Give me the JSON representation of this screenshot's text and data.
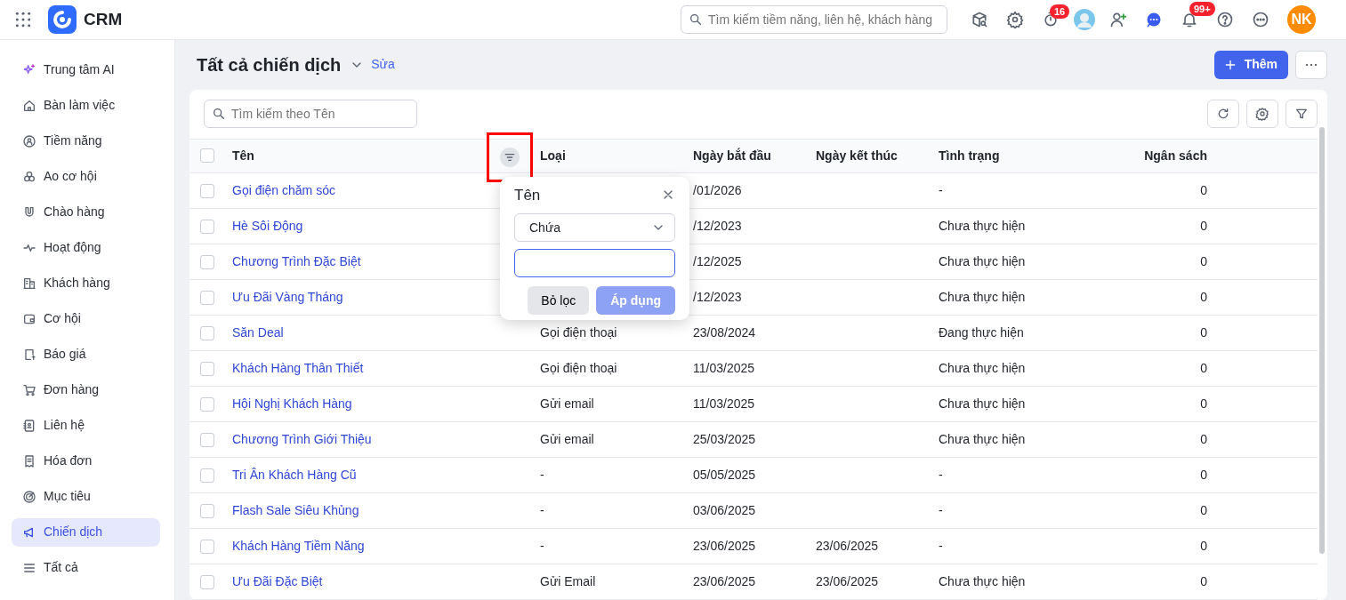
{
  "topbar": {
    "app_name": "CRM",
    "search_placeholder": "Tìm kiếm tiềm năng, liên hệ, khách hàng",
    "timer_badge": "16",
    "notification_badge": "99+",
    "avatar_initials": "NK"
  },
  "sidebar": {
    "items": [
      {
        "label": "Trung tâm AI",
        "selected": false
      },
      {
        "label": "Bàn làm việc",
        "selected": false
      },
      {
        "label": "Tiềm năng",
        "selected": false
      },
      {
        "label": "Ao cơ hội",
        "selected": false
      },
      {
        "label": "Chào hàng",
        "selected": false
      },
      {
        "label": "Hoạt động",
        "selected": false
      },
      {
        "label": "Khách hàng",
        "selected": false
      },
      {
        "label": "Cơ hội",
        "selected": false
      },
      {
        "label": "Báo giá",
        "selected": false
      },
      {
        "label": "Đơn hàng",
        "selected": false
      },
      {
        "label": "Liên hệ",
        "selected": false
      },
      {
        "label": "Hóa đơn",
        "selected": false
      },
      {
        "label": "Mục tiêu",
        "selected": false
      },
      {
        "label": "Chiến dịch",
        "selected": true
      },
      {
        "label": "Tất cả",
        "selected": false
      }
    ]
  },
  "header": {
    "title": "Tất cả chiến dịch",
    "edit_link": "Sửa",
    "add_button": "Thêm"
  },
  "table": {
    "search_placeholder": "Tìm kiếm theo Tên",
    "select_all_checked": false,
    "columns": [
      {
        "label": "Tên"
      },
      {
        "label": "Loại"
      },
      {
        "label": "Ngày bắt đầu"
      },
      {
        "label": "Ngày kết thúc"
      },
      {
        "label": "Tình trạng"
      },
      {
        "label": "Ngân sách"
      }
    ],
    "rows": [
      {
        "checked": false,
        "name": "Gọi điện chăm sóc",
        "start": "/01/2026",
        "status": "-",
        "budget": "0"
      },
      {
        "checked": false,
        "name": "Hè Sôi Động",
        "start": "/12/2023",
        "status": "Chưa thực hiện",
        "budget": "0"
      },
      {
        "checked": false,
        "name": "Chương Trình Đặc Biệt",
        "start": "/12/2025",
        "status": "Chưa thực hiện",
        "budget": "0"
      },
      {
        "checked": false,
        "name": "Ưu Đãi Vàng Tháng",
        "start": "/12/2023",
        "status": "Chưa thực hiện",
        "budget": "0"
      },
      {
        "checked": false,
        "name": "Săn Deal",
        "type": "Gọi điện thoại",
        "start": "23/08/2024",
        "status": "Đang thực hiện",
        "budget": "0"
      },
      {
        "checked": false,
        "name": "Khách Hàng Thân Thiết",
        "type": "Gọi điện thoại",
        "start": "11/03/2025",
        "status": "Chưa thực hiện",
        "budget": "0"
      },
      {
        "checked": false,
        "name": "Hội Nghị Khách Hàng",
        "type": "Gửi email",
        "start": "11/03/2025",
        "status": "Chưa thực hiện",
        "budget": "0"
      },
      {
        "checked": false,
        "name": "Chương Trình Giới Thiệu",
        "type": "Gửi email",
        "start": "25/03/2025",
        "status": "Chưa thực hiện",
        "budget": "0"
      },
      {
        "checked": false,
        "name": "Tri Ân Khách Hàng Cũ",
        "type": "-",
        "start": "05/05/2025",
        "status": "-",
        "budget": "0"
      },
      {
        "checked": false,
        "name": "Flash Sale Siêu Khủng",
        "type": "-",
        "start": "03/06/2025",
        "status": "-",
        "budget": "0"
      },
      {
        "checked": false,
        "name": "Khách Hàng Tiềm Năng",
        "type": "-",
        "start": "23/06/2025",
        "end": "23/06/2025",
        "status": "-",
        "budget": "0"
      },
      {
        "checked": false,
        "name": "Ưu Đãi Đặc Biệt",
        "type": "Gửi Email",
        "start": "23/06/2025",
        "end": "23/06/2025",
        "status": "Chưa thực hiện",
        "budget": "0"
      }
    ]
  },
  "filter_popup": {
    "title": "Tên",
    "operator": "Chứa",
    "clear_button": "Bỏ lọc",
    "apply_button": "Áp dụng",
    "apply_disabled": true
  }
}
